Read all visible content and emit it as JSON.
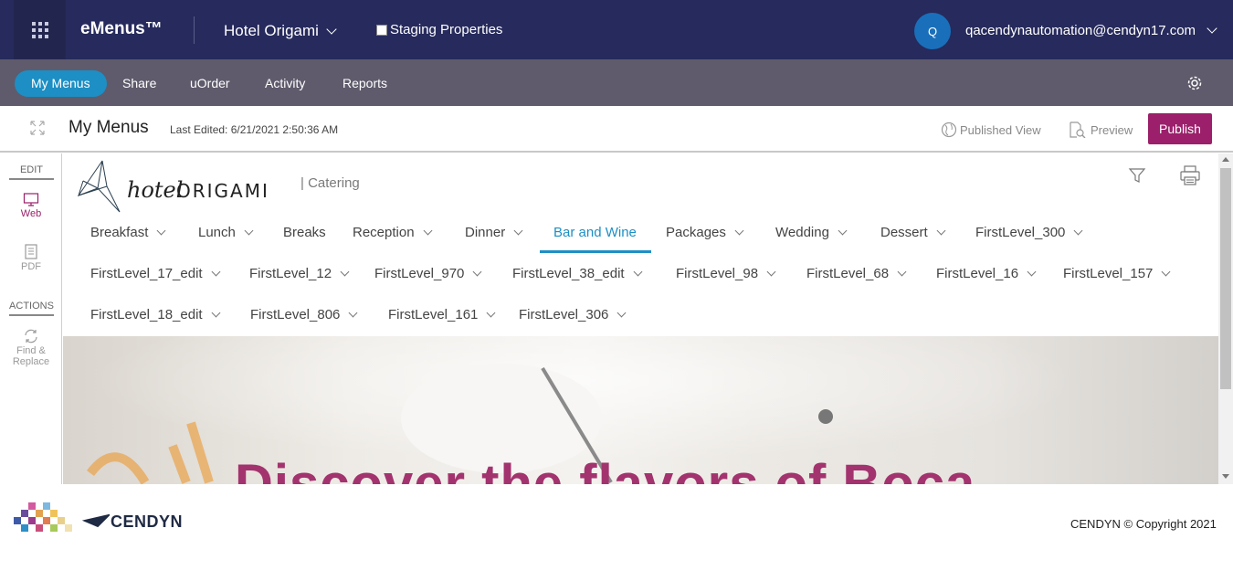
{
  "topbar": {
    "apps_icon": "grid-icon",
    "brand": "eMenus™",
    "property": "Hotel Origami",
    "staging_label": "Staging Properties",
    "avatar_initial": "Q",
    "user_email": "qacendynautomation@cendyn17.com"
  },
  "nav": {
    "items": [
      "My Menus",
      "Share",
      "uOrder",
      "Activity",
      "Reports"
    ],
    "active": "My Menus",
    "settings_icon": "gear-icon"
  },
  "page": {
    "title": "My Menus",
    "last_edited": "Last Edited: 6/21/2021 2:50:36 AM",
    "published_view": "Published View",
    "preview": "Preview",
    "publish": "Publish"
  },
  "rail": {
    "edit_heading": "EDIT",
    "web": "Web",
    "pdf": "PDF",
    "actions_heading": "ACTIONS",
    "find_replace_1": "Find &",
    "find_replace_2": "Replace"
  },
  "preview": {
    "logo_text_1": "hotel",
    "logo_text_2": "ORIGAMI",
    "section": "| Catering",
    "menu_row1": [
      "Breakfast",
      "Lunch",
      "Breaks",
      "Reception",
      "Dinner",
      "Bar and Wine",
      "Packages",
      "Wedding",
      "Dessert",
      "FirstLevel_300"
    ],
    "menu_row2": [
      "FirstLevel_17_edit",
      "FirstLevel_12",
      "FirstLevel_970",
      "FirstLevel_38_edit",
      "FirstLevel_98",
      "FirstLevel_68",
      "FirstLevel_16",
      "FirstLevel_157"
    ],
    "menu_row3": [
      "FirstLevel_18_edit",
      "FirstLevel_806",
      "FirstLevel_161",
      "FirstLevel_306"
    ],
    "active_tab": "Bar and Wine",
    "hero_title": "Discover the flavors of Boca"
  },
  "footer": {
    "company": "CENDYN",
    "copyright": "CENDYN © Copyright 2021"
  },
  "colors": {
    "topbar": "#262a5c",
    "navbar": "#5f5b6c",
    "accent_blue": "#1d8fc4",
    "publish": "#9b1f6a"
  }
}
